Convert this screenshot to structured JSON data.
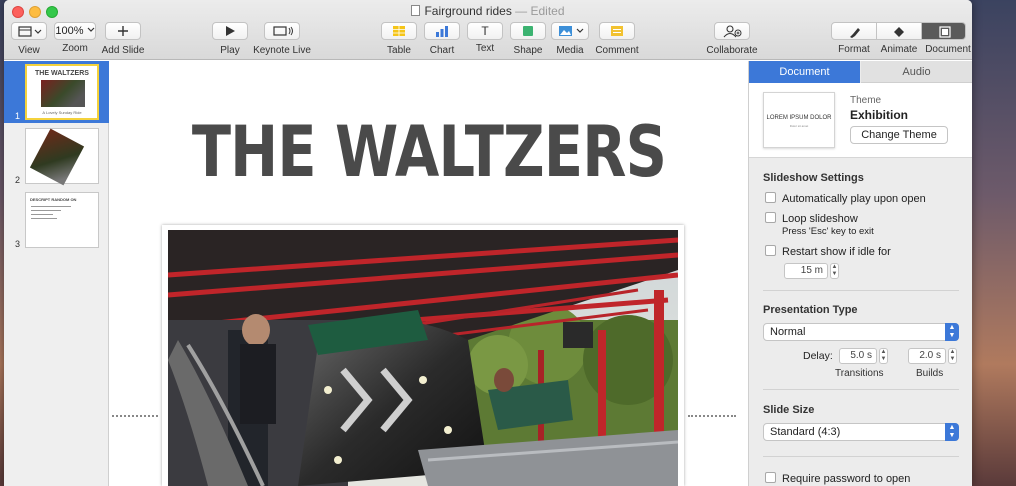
{
  "window": {
    "title": "Fairground rides",
    "status": "— Edited"
  },
  "toolbar": {
    "view": "View",
    "zoom_value": "100%",
    "zoom": "Zoom",
    "add_slide": "Add Slide",
    "play": "Play",
    "keynote_live": "Keynote Live",
    "table": "Table",
    "chart": "Chart",
    "text": "Text",
    "shape": "Shape",
    "media": "Media",
    "comment": "Comment",
    "collaborate": "Collaborate",
    "format": "Format",
    "animate": "Animate",
    "document": "Document",
    "text_glyph": "T",
    "colors": {
      "table": "#f5c518",
      "chart": "#3c78d8",
      "shape": "#3cb371",
      "media": "#3c8fd8",
      "comment": "#f2c230"
    }
  },
  "navigator": {
    "slides": [
      {
        "number": "1",
        "title": "THE WALTZERS",
        "caption": "A Lovely Sunday Ride"
      },
      {
        "number": "2"
      },
      {
        "number": "3",
        "heading": "DESCRIPT RANDOM ON"
      }
    ]
  },
  "slide": {
    "title": "THE WALTZERS"
  },
  "inspector": {
    "tabs": {
      "document": "Document",
      "audio": "Audio"
    },
    "theme": {
      "preview_title": "LOREM IPSUM DOLOR",
      "preview_sub": "Dolor sit amet",
      "label": "Theme",
      "name": "Exhibition",
      "change_button": "Change Theme"
    },
    "slideshow": {
      "heading": "Slideshow Settings",
      "auto_play": "Automatically play upon open",
      "loop": "Loop slideshow",
      "loop_note": "Press 'Esc' key to exit",
      "restart": "Restart show if idle for",
      "idle_value": "15 m"
    },
    "presentation": {
      "heading": "Presentation Type",
      "type_value": "Normal",
      "delay_label": "Delay:",
      "transitions_value": "5.0 s",
      "builds_value": "2.0 s",
      "transitions_label": "Transitions",
      "builds_label": "Builds"
    },
    "slide_size": {
      "heading": "Slide Size",
      "value": "Standard (4:3)"
    },
    "password": {
      "label": "Require password to open"
    }
  }
}
